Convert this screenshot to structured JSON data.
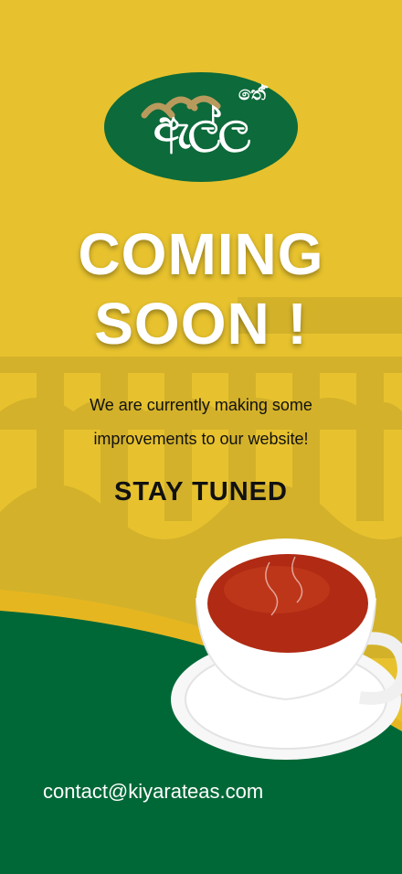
{
  "logo": {
    "main_text": "ඇල්ල",
    "top_text": "තේ",
    "colors": {
      "oval": "#0d6a3a",
      "arcs": "#b99a5d"
    }
  },
  "headline": {
    "line1": "COMING",
    "line2": "SOON !"
  },
  "message": {
    "line1": "We are currently making some",
    "line2": "improvements to our website!"
  },
  "cta": "STAY TUNED",
  "contact": {
    "email": "contact@kiyarateas.com"
  },
  "colors": {
    "background_yellow": "#e7c22e",
    "band_green": "#006837",
    "text_dark": "#111111",
    "tea": "#b02a14"
  },
  "icons": {
    "cup": "tea-cup-icon",
    "steam": "steam-icon"
  }
}
